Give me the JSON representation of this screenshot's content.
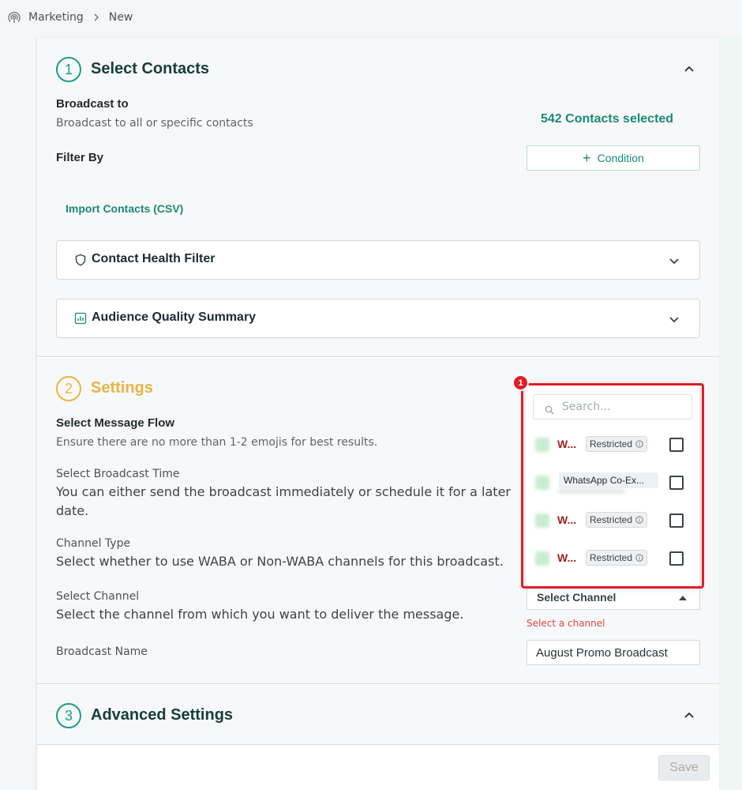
{
  "breadcrumb": {
    "section": "Marketing",
    "current": "New"
  },
  "step1": {
    "number": "1",
    "title": "Select Contacts",
    "broadcast_to_label": "Broadcast to",
    "broadcast_to_desc": "Broadcast to all or specific contacts",
    "contacts_selected": "542 Contacts selected",
    "filter_by_label": "Filter By",
    "condition_button": "Condition",
    "import_link": "Import Contacts (CSV)",
    "health_filter_title": "Contact Health Filter",
    "audience_summary_title": "Audience Quality Summary"
  },
  "step2": {
    "number": "2",
    "title": "Settings",
    "message_flow_label": "Select Message Flow",
    "message_flow_desc": "Ensure there are no more than 1-2 emojis for best results.",
    "broadcast_time_label": "Select Broadcast Time",
    "broadcast_time_desc": "You can either send the broadcast immediately or schedule it for a later date.",
    "channel_type_label": "Channel Type",
    "channel_type_desc": "Select whether to use WABA or Non-WABA channels for this broadcast.",
    "select_channel_label": "Select Channel",
    "select_channel_desc": "Select the channel from which you want to deliver the message.",
    "select_channel_value": "Select Channel",
    "select_channel_error": "Select a channel",
    "broadcast_name_label": "Broadcast Name",
    "broadcast_name_value": "August Promo Broadcast"
  },
  "step3": {
    "number": "3",
    "title": "Advanced Settings"
  },
  "footer": {
    "save_label": "Save"
  },
  "channel_dropdown": {
    "search_placeholder": "Search...",
    "items": [
      {
        "name": "W...",
        "badge": "Restricted"
      },
      {
        "name": "",
        "badge": "WhatsApp Co-Ex..."
      },
      {
        "name": "W...",
        "badge": "Restricted"
      },
      {
        "name": "W...",
        "badge": "Restricted"
      }
    ]
  },
  "annotation": {
    "marker": "1"
  },
  "colors": {
    "accent": "#1a9e85",
    "amber": "#f0b43c",
    "error": "#e04545",
    "highlight": "#e11d28"
  }
}
